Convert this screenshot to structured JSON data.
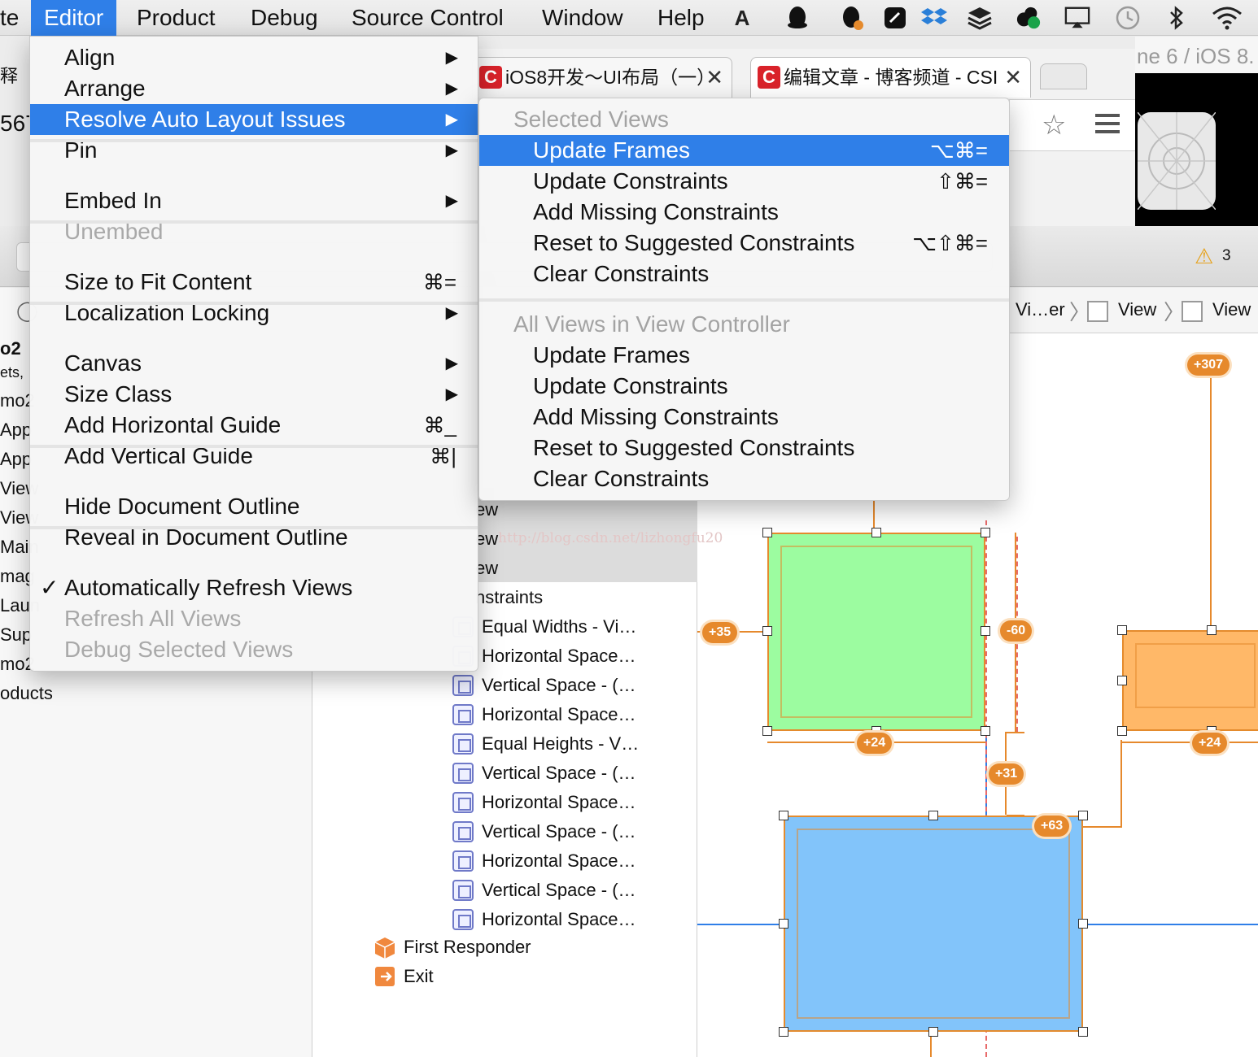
{
  "menubar": {
    "partial_left": "te",
    "items": [
      "Editor",
      "Product",
      "Debug",
      "Source Control",
      "Window",
      "Help"
    ],
    "tray_icons": [
      "adobe-icon",
      "qq-icon",
      "qq-alt-icon",
      "evernote-icon",
      "dropbox-icon",
      "stack-icon",
      "sync-icon",
      "airplay-icon",
      "time-machine-icon",
      "bluetooth-icon",
      "wifi-icon"
    ]
  },
  "browser": {
    "tab1": "iOS8开发～UI布局（一）",
    "tab2": "编辑文章 - 博客频道 - CSI",
    "tab_close": "✕",
    "partial_left_text": "释",
    "partial_left_number": "567"
  },
  "simulator": {
    "title_fragment": "ne 6 / iOS 8."
  },
  "toolbar": {
    "warning_count": "3"
  },
  "jumpbar": {
    "crumbs": [
      "Vi…er",
      "View",
      "View"
    ]
  },
  "navigator": {
    "fragments": [
      "o2",
      "ets,",
      "mo2",
      "App",
      "App",
      "View",
      "View",
      "Main",
      "mag",
      "Laun",
      "Sup",
      "mo2",
      "oducts"
    ]
  },
  "outline": {
    "view_rows": [
      "ew",
      "ew",
      "ew"
    ],
    "constraints_header": "nstraints",
    "constraints": [
      "Equal Widths - Vi…",
      "Horizontal Space…",
      "Vertical Space - (…",
      "Horizontal Space…",
      "Equal Heights - V…",
      "Vertical Space - (…",
      "Horizontal Space…",
      "Vertical Space - (…",
      "Horizontal Space…",
      "Vertical Space - (…",
      "Horizontal Space…"
    ],
    "first_responder": "First Responder",
    "exit": "Exit"
  },
  "canvas": {
    "watermark": "http://blog.csdn.net/lizhongfu20",
    "badges": [
      "+307",
      "+35",
      "-60",
      "+24",
      "+24",
      "+31",
      "+63"
    ],
    "colors": {
      "green": "#9cfca0",
      "orange": "#ffb868",
      "blue": "#82c4fa",
      "constraint": "#e6892c",
      "selection": "#2f7fe8"
    }
  },
  "editor_menu": {
    "groups": [
      [
        {
          "label": "Align",
          "submenu": true
        },
        {
          "label": "Arrange",
          "submenu": true
        },
        {
          "label": "Resolve Auto Layout Issues",
          "submenu": true,
          "selected": true
        },
        {
          "label": "Pin",
          "submenu": true
        }
      ],
      [
        {
          "label": "Embed In",
          "submenu": true
        },
        {
          "label": "Unembed",
          "disabled": true
        }
      ],
      [
        {
          "label": "Size to Fit Content",
          "shortcut": "⌘="
        },
        {
          "label": "Localization Locking",
          "submenu": true
        }
      ],
      [
        {
          "label": "Canvas",
          "submenu": true
        },
        {
          "label": "Size Class",
          "submenu": true
        },
        {
          "label": "Add Horizontal Guide",
          "shortcut": "⌘_"
        },
        {
          "label": "Add Vertical Guide",
          "shortcut": "⌘|"
        }
      ],
      [
        {
          "label": "Hide Document Outline"
        },
        {
          "label": "Reveal in Document Outline"
        }
      ],
      [
        {
          "label": "Automatically Refresh Views",
          "checked": true
        },
        {
          "label": "Refresh All Views",
          "disabled": true
        },
        {
          "label": "Debug Selected Views",
          "disabled": true
        }
      ]
    ],
    "check_mark": "✓",
    "submenu_arrow": "▶"
  },
  "resolve_menu": {
    "section1": "Selected Views",
    "items1": [
      {
        "label": "Update Frames",
        "shortcut": "⌥⌘=",
        "selected": true
      },
      {
        "label": "Update Constraints",
        "shortcut": "⇧⌘="
      },
      {
        "label": "Add Missing Constraints"
      },
      {
        "label": "Reset to Suggested Constraints",
        "shortcut": "⌥⇧⌘="
      },
      {
        "label": "Clear Constraints"
      }
    ],
    "section2": "All Views in View Controller",
    "items2": [
      {
        "label": "Update Frames"
      },
      {
        "label": "Update Constraints"
      },
      {
        "label": "Add Missing Constraints"
      },
      {
        "label": "Reset to Suggested Constraints"
      },
      {
        "label": "Clear Constraints"
      }
    ]
  }
}
